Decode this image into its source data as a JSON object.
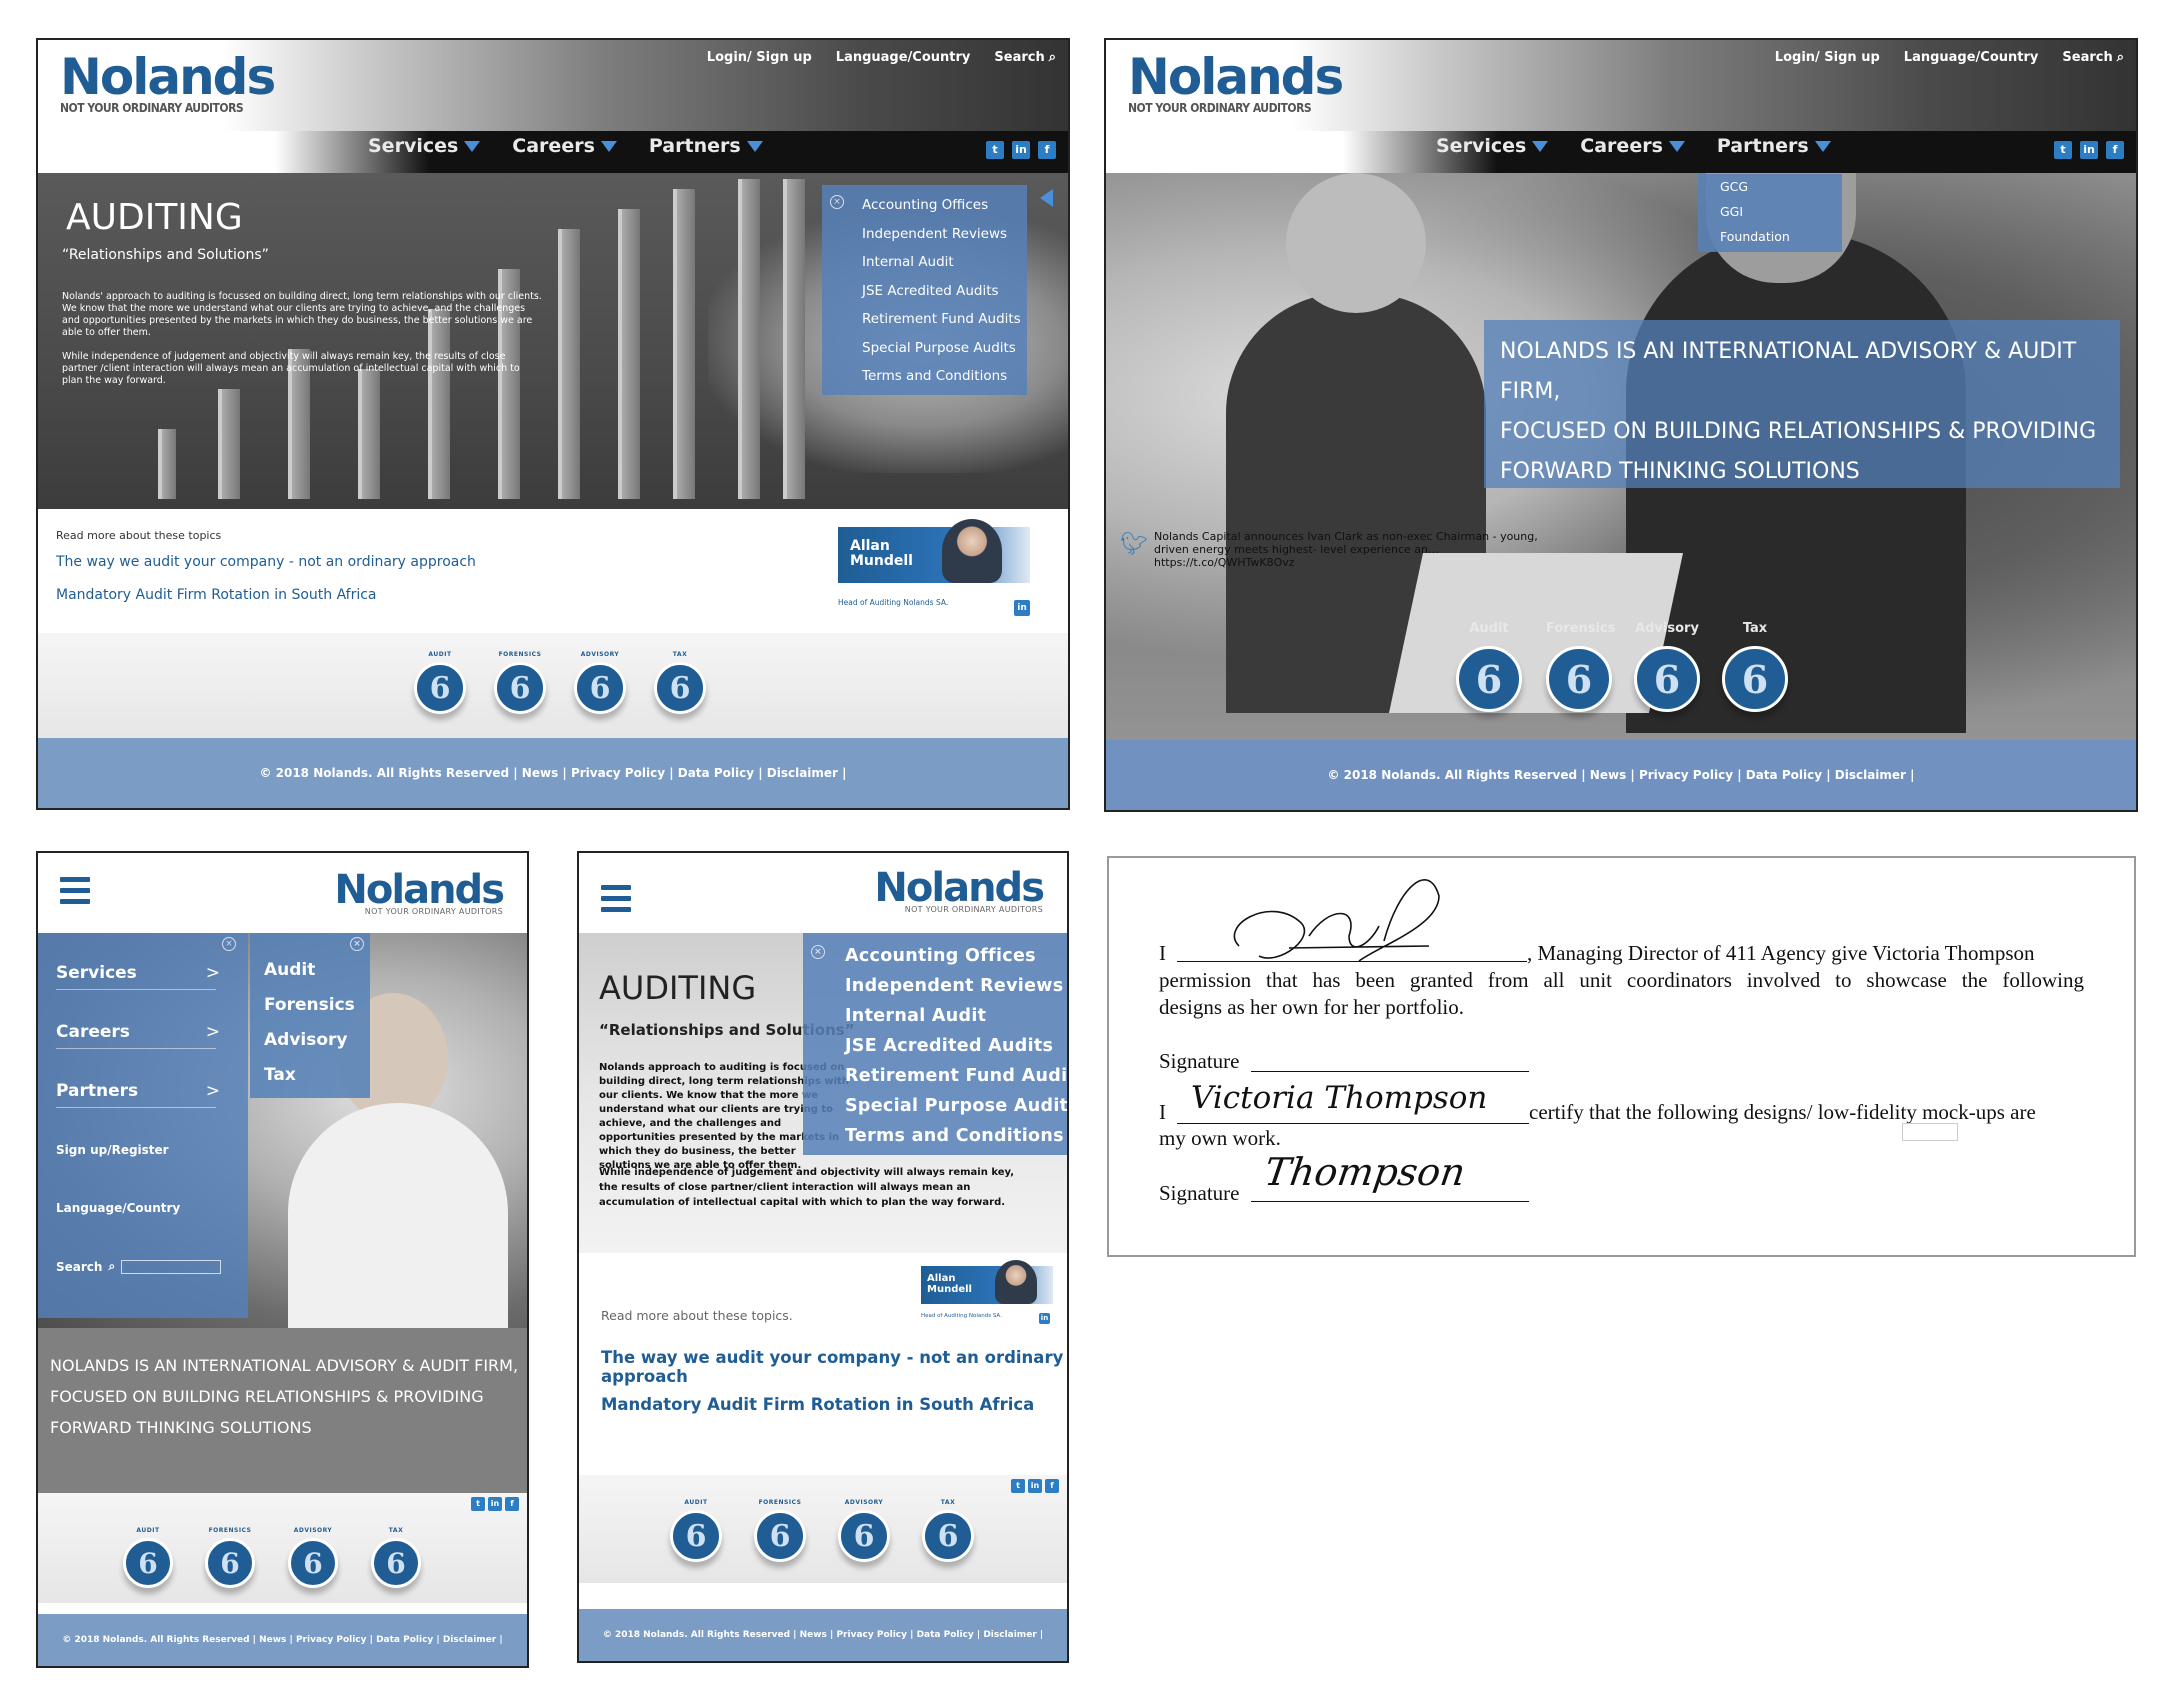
{
  "brand": {
    "logo": "Nolands",
    "tagline": "NOT YOUR ORDINARY AUDITORS",
    "colors": {
      "primary": "#1f5d94",
      "overlay": "#5480b9",
      "footer": "#7b9cc5"
    }
  },
  "header": {
    "login": "Login/ Sign up",
    "language": "Language/Country",
    "search": "Search",
    "nav": [
      "Services",
      "Careers",
      "Partners"
    ],
    "social_icons": [
      "twitter-icon",
      "linkedin-icon",
      "facebook-icon"
    ]
  },
  "auditing_page": {
    "title": "AUDITING",
    "subtitle": "“Relationships and Solutions”",
    "subtitle_mobile": "“Relationships and Solutions”",
    "body_p1": "Nolands' approach to auditing is focussed on building direct, long term relationships with our clients. We know that the more we understand what our clients are trying to achieve, and the challenges and opportunities presented by the markets in which they do business, the better solutions we are able to offer them.",
    "body_p2": "While independence of judgement and objectivity will always remain key, the results of close partner /client interaction will always mean an accumulation of intellectual capital with which to plan the way forward.",
    "body_p1_mobile": "Nolands approach to auditing is focused on building direct, long term relationships with our clients. We know that the more we understand what our clients are trying to achieve, and the challenges and opportunities presented by the markets in which they do business, the better solutions we are able to offer them.",
    "body_p2_mobile": "While independence of judgement and objectivity will always remain key, the results of close partner/client interaction will always mean an accumulation of intellectual capital with which to plan the way forward.",
    "menu": [
      "Accounting Offices",
      "Independent Reviews",
      "Internal Audit",
      "JSE Acredited Audits",
      "Retirement Fund Audits",
      "Special Purpose Audits",
      "Terms and Conditions"
    ],
    "read_more": "Read more about these topics",
    "read_more_mobile": "Read more about these topics.",
    "links": [
      "The way we audit your company - not an ordinary approach",
      "Mandatory Audit Firm Rotation in South Africa"
    ],
    "person_name": "Allan Mundell",
    "person_first": "Allan",
    "person_last": "Mundell",
    "person_role": "Head of Auditing Nolands SA."
  },
  "services": {
    "labels_small": [
      "AUDIT",
      "FORENSICS",
      "ADVISORY",
      "TAX"
    ],
    "labels": [
      "Audit",
      "Forensics",
      "Advisory",
      "Tax"
    ],
    "icon_glyph": "6"
  },
  "home_page": {
    "partners_menu": [
      "GCG",
      "GGI",
      "Foundation"
    ],
    "tagline_lines": [
      "NOLANDS IS AN INTERNATIONAL ADVISORY & AUDIT FIRM,",
      "FOCUSED ON BUILDING RELATIONSHIPS & PROVIDING",
      "FORWARD THINKING SOLUTIONS"
    ],
    "tweet": "Nolands Capital announces Ivan Clark as non-exec Chairman - young, driven energy meets highest- level experience an… https://t.co/QWHTwK8Ovz"
  },
  "mobile_menu": {
    "items": [
      "Services",
      "Careers",
      "Partners"
    ],
    "signup": "Sign up/Register",
    "language": "Language/Country",
    "search": "Search",
    "services_submenu": [
      "Audit",
      "Forensics",
      "Advisory",
      "Tax"
    ]
  },
  "footer": {
    "text": "© 2018 Nolands. All Rights Reserved | News | Privacy Policy | Data Policy | Disclaimer |"
  },
  "permission": {
    "i": "I",
    "line1_rest": ", Managing Director of 411 Agency give Victoria Thompson",
    "line2": "permission that has been granted from all unit coordinators involved to showcase the following",
    "line3": "designs as her own for her portfolio.",
    "signature_label": "Signature",
    "certify_name": "Victoria Thompson",
    "certify_rest": "certify that the following designs/ low-fidelity mock-ups are",
    "certify_line2": "my own work.",
    "signature2": "Thompson"
  }
}
